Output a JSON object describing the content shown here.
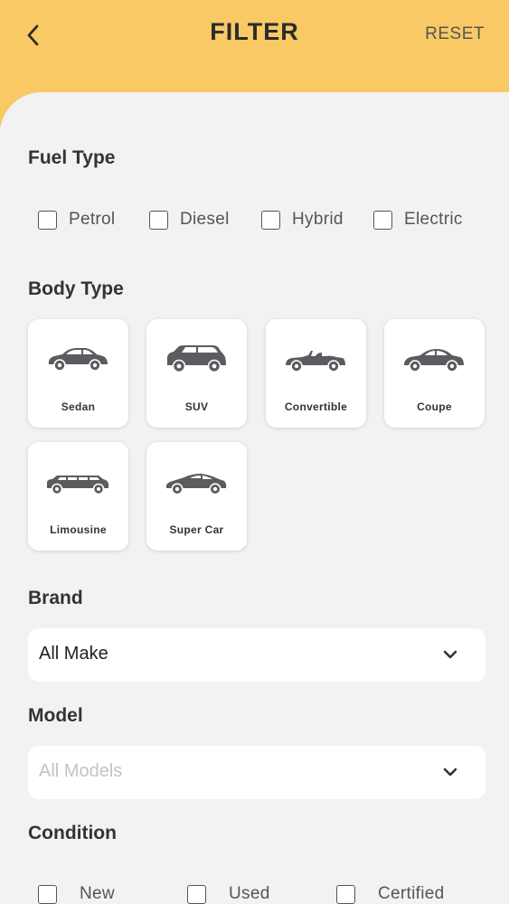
{
  "header": {
    "title": "FILTER",
    "reset_label": "RESET"
  },
  "fuel_type": {
    "title": "Fuel Type",
    "options": [
      {
        "label": "Petrol",
        "checked": false
      },
      {
        "label": "Diesel",
        "checked": false
      },
      {
        "label": "Hybrid",
        "checked": false
      },
      {
        "label": "Electric",
        "checked": false
      }
    ]
  },
  "body_type": {
    "title": "Body Type",
    "options": [
      {
        "label": "Sedan",
        "icon": "sedan-icon"
      },
      {
        "label": "SUV",
        "icon": "suv-icon"
      },
      {
        "label": "Convertible",
        "icon": "convertible-icon"
      },
      {
        "label": "Coupe",
        "icon": "coupe-icon"
      },
      {
        "label": "Limousine",
        "icon": "limousine-icon"
      },
      {
        "label": "Super Car",
        "icon": "supercar-icon"
      }
    ]
  },
  "brand": {
    "title": "Brand",
    "value": "All Make"
  },
  "model": {
    "title": "Model",
    "placeholder": "All Models"
  },
  "condition": {
    "title": "Condition",
    "options": [
      {
        "label": "New",
        "checked": false
      },
      {
        "label": "Used",
        "checked": false
      },
      {
        "label": "Certified",
        "checked": false
      }
    ]
  },
  "colors": {
    "header_bg": "#f8c965",
    "page_bg": "#f2f2f4",
    "icon": "#5c5c60"
  }
}
